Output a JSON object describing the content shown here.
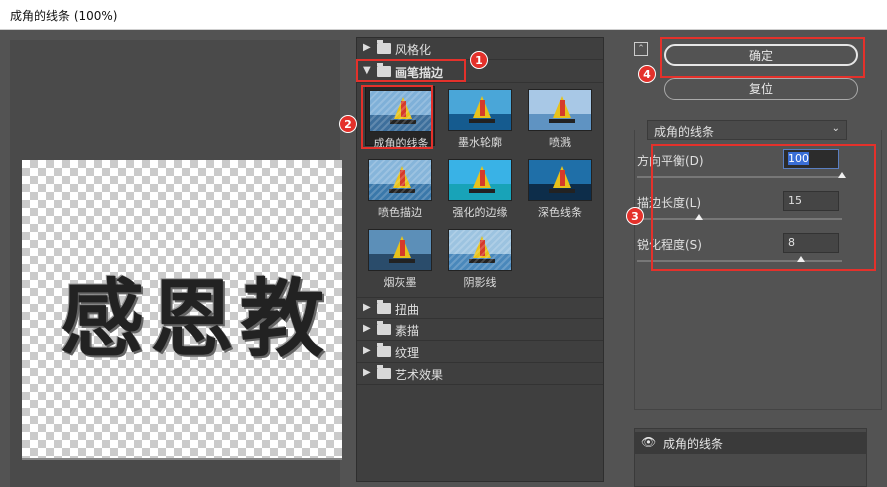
{
  "window": {
    "title": "成角的线条 (100%)"
  },
  "preview": {
    "text": "感恩教"
  },
  "gallery": {
    "categories_top": [
      {
        "label": "风格化",
        "expanded": false
      },
      {
        "label": "画笔描边",
        "expanded": true
      }
    ],
    "filters": [
      {
        "label": "成角的线条",
        "selected": true
      },
      {
        "label": "墨水轮廓",
        "selected": false
      },
      {
        "label": "喷溅",
        "selected": false
      },
      {
        "label": "喷色描边",
        "selected": false
      },
      {
        "label": "强化的边缘",
        "selected": false
      },
      {
        "label": "深色线条",
        "selected": false
      },
      {
        "label": "烟灰墨",
        "selected": false
      },
      {
        "label": "阴影线",
        "selected": false
      }
    ],
    "categories_bottom": [
      {
        "label": "扭曲"
      },
      {
        "label": "素描"
      },
      {
        "label": "纹理"
      },
      {
        "label": "艺术效果"
      }
    ]
  },
  "buttons": {
    "ok": "确定",
    "reset": "复位"
  },
  "filter_select": {
    "value": "成角的线条"
  },
  "params": [
    {
      "label": "方向平衡(D)",
      "value": "100",
      "slider_fraction": 1.0
    },
    {
      "label": "描边长度(L)",
      "value": "15",
      "slider_fraction": 0.3
    },
    {
      "label": "锐化程度(S)",
      "value": "8",
      "slider_fraction": 0.8
    }
  ],
  "layers": [
    {
      "name": "成角的线条",
      "visible": true
    }
  ],
  "annotations": [
    "1",
    "2",
    "3",
    "4"
  ],
  "colors": {
    "annotation_red": "#e4312b",
    "background": "#535353",
    "gallery_bg": "#3f3f3f"
  }
}
